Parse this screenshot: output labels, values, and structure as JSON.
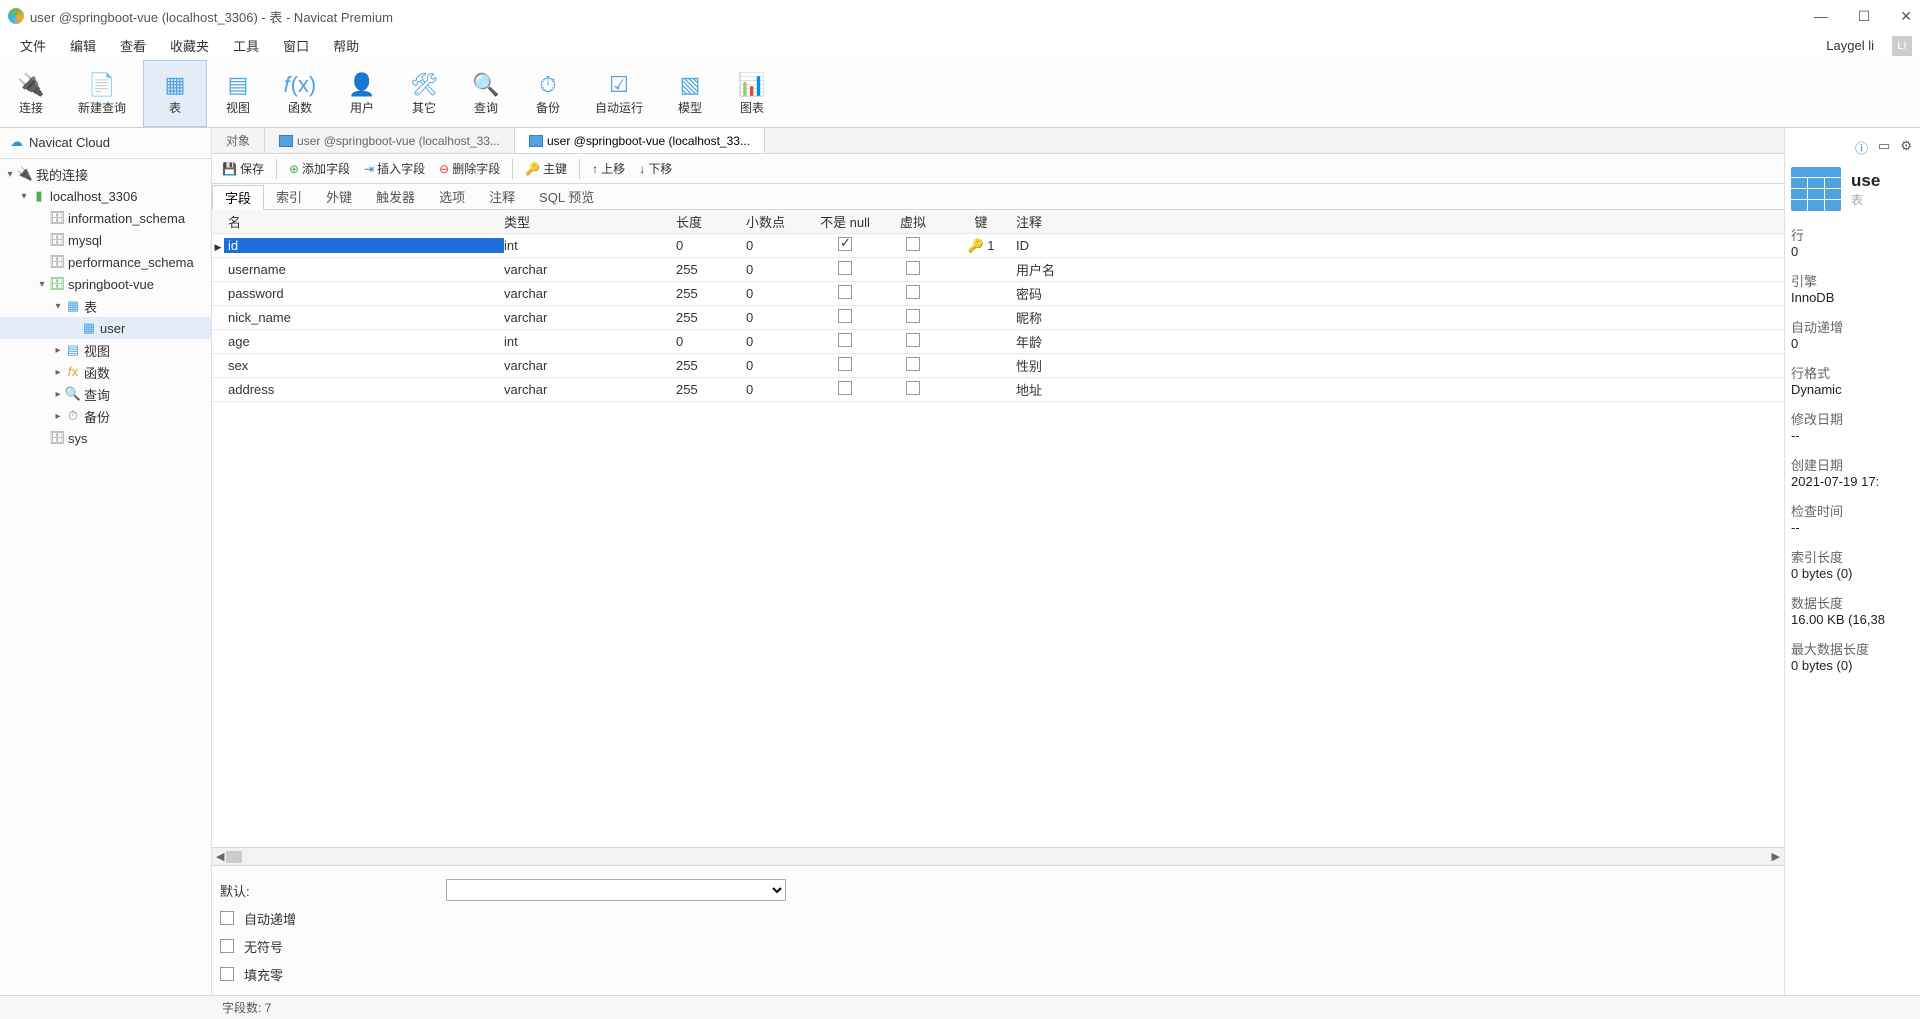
{
  "window": {
    "title": "user @springboot-vue (localhost_3306) - 表 - Navicat Premium"
  },
  "menubar": {
    "items": [
      "文件",
      "编辑",
      "查看",
      "收藏夹",
      "工具",
      "窗口",
      "帮助"
    ],
    "user": "Laygel li",
    "user_initial": "LI"
  },
  "toolbar": {
    "items": [
      {
        "label": "连接"
      },
      {
        "label": "新建查询"
      },
      {
        "label": "表"
      },
      {
        "label": "视图"
      },
      {
        "label": "函数"
      },
      {
        "label": "用户"
      },
      {
        "label": "其它"
      },
      {
        "label": "查询"
      },
      {
        "label": "备份"
      },
      {
        "label": "自动运行"
      },
      {
        "label": "模型"
      },
      {
        "label": "图表"
      }
    ],
    "active_index": 2
  },
  "sidebar": {
    "cloud_label": "Navicat Cloud",
    "my_conn": "我的连接",
    "conn": "localhost_3306",
    "dbs": [
      "information_schema",
      "mysql",
      "performance_schema",
      "springboot-vue",
      "sys"
    ],
    "active_db_index": 3,
    "db_children": {
      "tables_label": "表",
      "tables": [
        "user"
      ],
      "views": "视图",
      "funcs": "函数",
      "queries": "查询",
      "backups": "备份"
    }
  },
  "tabs": {
    "items": [
      {
        "label": "对象",
        "type": "plain"
      },
      {
        "label": "user @springboot-vue (localhost_33...",
        "type": "table"
      },
      {
        "label": "user @springboot-vue (localhost_33...",
        "type": "table"
      }
    ],
    "active_index": 2
  },
  "action_bar": {
    "save": "保存",
    "add_field": "添加字段",
    "insert_field": "插入字段",
    "delete_field": "删除字段",
    "primary_key": "主键",
    "move_up": "上移",
    "move_down": "下移"
  },
  "sub_tabs": {
    "items": [
      "字段",
      "索引",
      "外键",
      "触发器",
      "选项",
      "注释",
      "SQL 预览"
    ],
    "active_index": 0
  },
  "grid": {
    "headers": {
      "name": "名",
      "type": "类型",
      "length": "长度",
      "decimals": "小数点",
      "not_null": "不是 null",
      "virtual": "虚拟",
      "key": "键",
      "comment": "注释"
    },
    "rows": [
      {
        "name": "id",
        "type": "int",
        "length": "0",
        "decimals": "0",
        "not_null": true,
        "virtual": false,
        "key": "1",
        "comment": "ID"
      },
      {
        "name": "username",
        "type": "varchar",
        "length": "255",
        "decimals": "0",
        "not_null": false,
        "virtual": false,
        "key": "",
        "comment": "用户名"
      },
      {
        "name": "password",
        "type": "varchar",
        "length": "255",
        "decimals": "0",
        "not_null": false,
        "virtual": false,
        "key": "",
        "comment": "密码"
      },
      {
        "name": "nick_name",
        "type": "varchar",
        "length": "255",
        "decimals": "0",
        "not_null": false,
        "virtual": false,
        "key": "",
        "comment": "昵称"
      },
      {
        "name": "age",
        "type": "int",
        "length": "0",
        "decimals": "0",
        "not_null": false,
        "virtual": false,
        "key": "",
        "comment": "年龄"
      },
      {
        "name": "sex",
        "type": "varchar",
        "length": "255",
        "decimals": "0",
        "not_null": false,
        "virtual": false,
        "key": "",
        "comment": "性别"
      },
      {
        "name": "address",
        "type": "varchar",
        "length": "255",
        "decimals": "0",
        "not_null": false,
        "virtual": false,
        "key": "",
        "comment": "地址"
      }
    ],
    "selected_index": 0
  },
  "field_props": {
    "default_label": "默认:",
    "auto_inc": "自动递增",
    "unsigned": "无符号",
    "zerofill": "填充零"
  },
  "right_panel": {
    "title": "use",
    "subtitle": "表",
    "fields": [
      {
        "l": "行",
        "v": "0"
      },
      {
        "l": "引擎",
        "v": "InnoDB"
      },
      {
        "l": "自动递增",
        "v": "0"
      },
      {
        "l": "行格式",
        "v": "Dynamic"
      },
      {
        "l": "修改日期",
        "v": "--"
      },
      {
        "l": "创建日期",
        "v": "2021-07-19 17:"
      },
      {
        "l": "检查时间",
        "v": "--"
      },
      {
        "l": "索引长度",
        "v": "0 bytes (0)"
      },
      {
        "l": "数据长度",
        "v": "16.00 KB (16,38"
      },
      {
        "l": "最大数据长度",
        "v": "0 bytes (0)"
      }
    ]
  },
  "statusbar": {
    "field_count": "字段数: 7"
  }
}
